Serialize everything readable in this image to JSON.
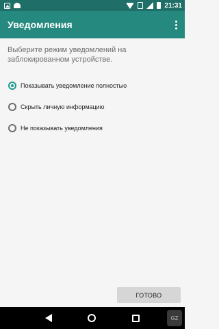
{
  "status_bar": {
    "time": "21:31",
    "left_icons": [
      "gallery-icon",
      "android-icon"
    ],
    "right_icons": [
      "wifi-icon",
      "no-sim-icon",
      "signal-icon",
      "battery-icon"
    ],
    "background_color": "#1f6f68"
  },
  "app_bar": {
    "title": "Уведомления",
    "background_color": "#26897f",
    "overflow_icon": "more-vert-icon"
  },
  "main": {
    "description": "Выберите режим уведомлений на заблокированном устройстве.",
    "options": [
      {
        "label": "Показывать уведомление полностью",
        "checked": true
      },
      {
        "label": "Скрыть личную информацию",
        "checked": false
      },
      {
        "label": "Не показывать уведомления",
        "checked": false
      }
    ],
    "accent_color": "#1f9a8c"
  },
  "footer": {
    "done_label": "ГОТОВО"
  },
  "nav_bar": {
    "icons": [
      "back-icon",
      "home-icon",
      "recents-icon"
    ]
  },
  "watermark": {
    "text": "GZ"
  }
}
